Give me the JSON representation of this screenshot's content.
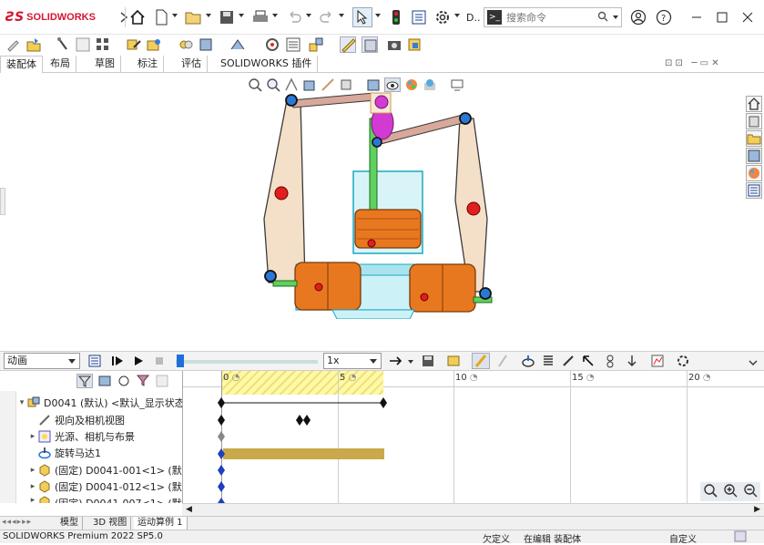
{
  "app": {
    "brand": "SOLIDWORKS",
    "title_abbrev": "D..",
    "search_placeholder": "搜索命令"
  },
  "command_tabs": [
    "装配体",
    "布局",
    "草图",
    "标注",
    "评估",
    "SOLIDWORKS 插件"
  ],
  "motion": {
    "study_type": "动画",
    "playback_speed": "1x"
  },
  "timeline": {
    "ticks": [
      "0",
      "5",
      "10",
      "15",
      "20"
    ]
  },
  "tree": {
    "items": [
      {
        "label": "D0041 (默认) <默认_显示状态",
        "icon": "assembly-icon"
      },
      {
        "label": "视向及相机视图",
        "icon": "camera-icon"
      },
      {
        "label": "光源、相机与布景",
        "icon": "lights-icon"
      },
      {
        "label": "旋转马达1",
        "icon": "motor-icon"
      },
      {
        "label": "(固定) D0041-001<1> (默",
        "icon": "part-icon"
      },
      {
        "label": "(固定) D0041-012<1> (默",
        "icon": "part-icon"
      },
      {
        "label": "(固定) D0041-007<1> (默",
        "icon": "part-icon"
      }
    ]
  },
  "bottom_tabs": [
    "模型",
    "3D 视图",
    "运动算例 1"
  ],
  "status": {
    "product": "SOLIDWORKS Premium 2022 SP5.0",
    "definition": "欠定义",
    "editing": "在编辑 装配体",
    "units": "自定义"
  },
  "colors": {
    "brand_red": "#d5152f",
    "key_bar_yellow": "#fff9a6",
    "motor_bar": "#c9a94a",
    "accent_blue": "#1e6fd9"
  }
}
